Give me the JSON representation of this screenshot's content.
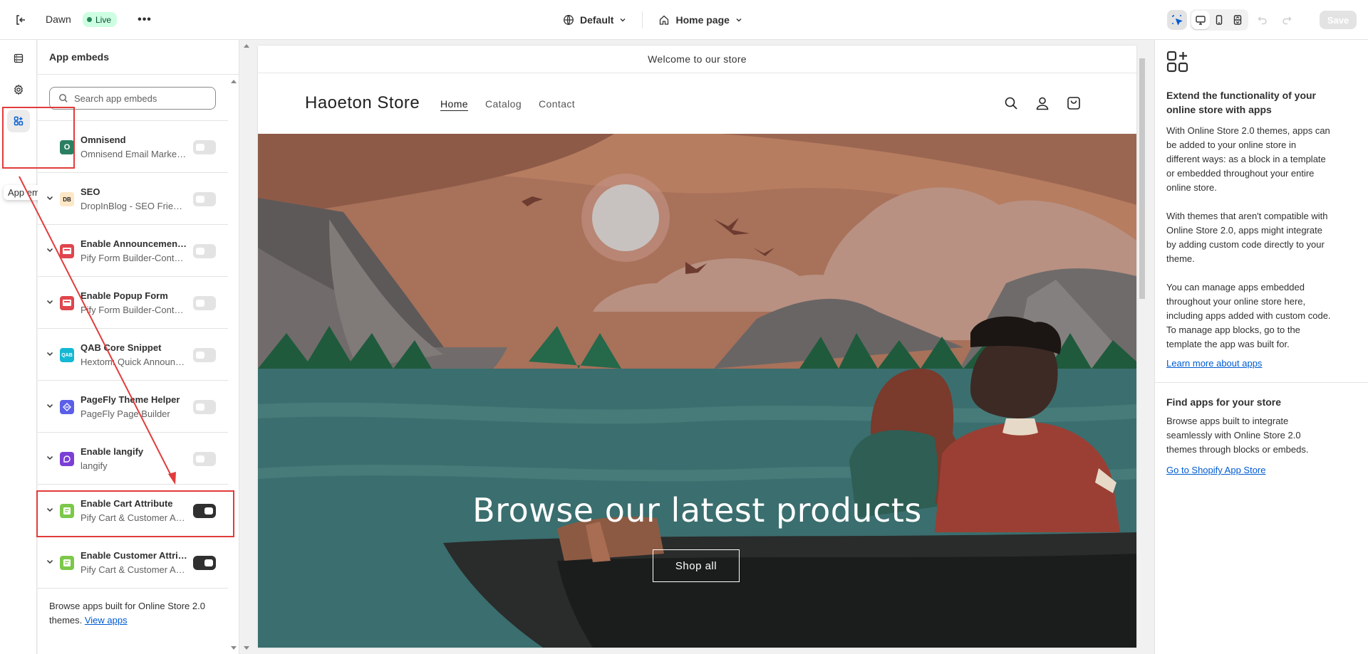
{
  "topbar": {
    "theme_name": "Dawn",
    "live_label": "Live",
    "more_label": "•••",
    "template_selector": "Default",
    "page_selector": "Home page",
    "save_label": "Save"
  },
  "rail": {
    "tooltip": "App embeds"
  },
  "panel": {
    "title": "App embeds",
    "search_placeholder": "Search app embeds",
    "items": [
      {
        "name": "Omnisend",
        "subtitle": "Omnisend Email Marketing & SMS",
        "icon": "O",
        "icon_color": "#2a7f62",
        "enabled": false,
        "has_chevron": false
      },
      {
        "name": "SEO",
        "subtitle": "DropInBlog - SEO Friendly Blog",
        "icon": "DB",
        "icon_color": "#fde7c6",
        "enabled": false,
        "has_chevron": true
      },
      {
        "name": "Enable Announcement Bar",
        "subtitle": "Pify Form Builder-Contact Form",
        "icon": "form",
        "icon_color": "#e0464d",
        "enabled": false,
        "has_chevron": true
      },
      {
        "name": "Enable Popup Form",
        "subtitle": "Pify Form Builder-Contact Form",
        "icon": "form",
        "icon_color": "#e0464d",
        "enabled": false,
        "has_chevron": true
      },
      {
        "name": "QAB Core Snippet",
        "subtitle": "Hextom: Quick Announcement Bar",
        "icon": "QAB",
        "icon_color": "#14b8d4",
        "enabled": false,
        "has_chevron": true
      },
      {
        "name": "PageFly Theme Helper",
        "subtitle": "PageFly Page Builder",
        "icon": "pf",
        "icon_color": "#5b5fe8",
        "enabled": false,
        "has_chevron": true
      },
      {
        "name": "Enable langify",
        "subtitle": "langify",
        "icon": "lg",
        "icon_color": "#7b3fd6",
        "enabled": false,
        "has_chevron": true
      },
      {
        "name": "Enable Cart Attribute",
        "subtitle": "Pify Cart & Customer Attributes",
        "icon": "cart",
        "icon_color": "#7cc84a",
        "enabled": true,
        "has_chevron": true
      },
      {
        "name": "Enable Customer Attributes",
        "subtitle": "Pify Cart & Customer Attributes",
        "icon": "cart",
        "icon_color": "#7cc84a",
        "enabled": true,
        "has_chevron": true
      }
    ],
    "footer_text": "Browse apps built for Online Store 2.0 themes. ",
    "footer_link": "View apps"
  },
  "preview": {
    "announcement": "Welcome to our store",
    "store_name": "Haoeton Store",
    "nav": [
      "Home",
      "Catalog",
      "Contact"
    ],
    "hero_title": "Browse our latest products",
    "hero_button": "Shop all"
  },
  "info": {
    "heading1": "Extend the functionality of your online store with apps",
    "para1": "With Online Store 2.0 themes, apps can be added to your online store in different ways: as a block in a template or embedded throughout your entire online store.",
    "para2": "With themes that aren't compatible with Online Store 2.0, apps might integrate by adding custom code directly to your theme.",
    "para3": "You can manage apps embedded throughout your online store here, including apps added with custom code. To manage app blocks, go to the template the app was built for.",
    "link1": "Learn more about apps",
    "heading2": "Find apps for your store",
    "para4": "Browse apps built to integrate seamlessly with Online Store 2.0 themes through blocks or embeds.",
    "link2": "Go to Shopify App Store"
  },
  "colors": {
    "annotation_red": "#e23b3b",
    "link_blue": "#005bd3",
    "live_green": "#29845a"
  }
}
